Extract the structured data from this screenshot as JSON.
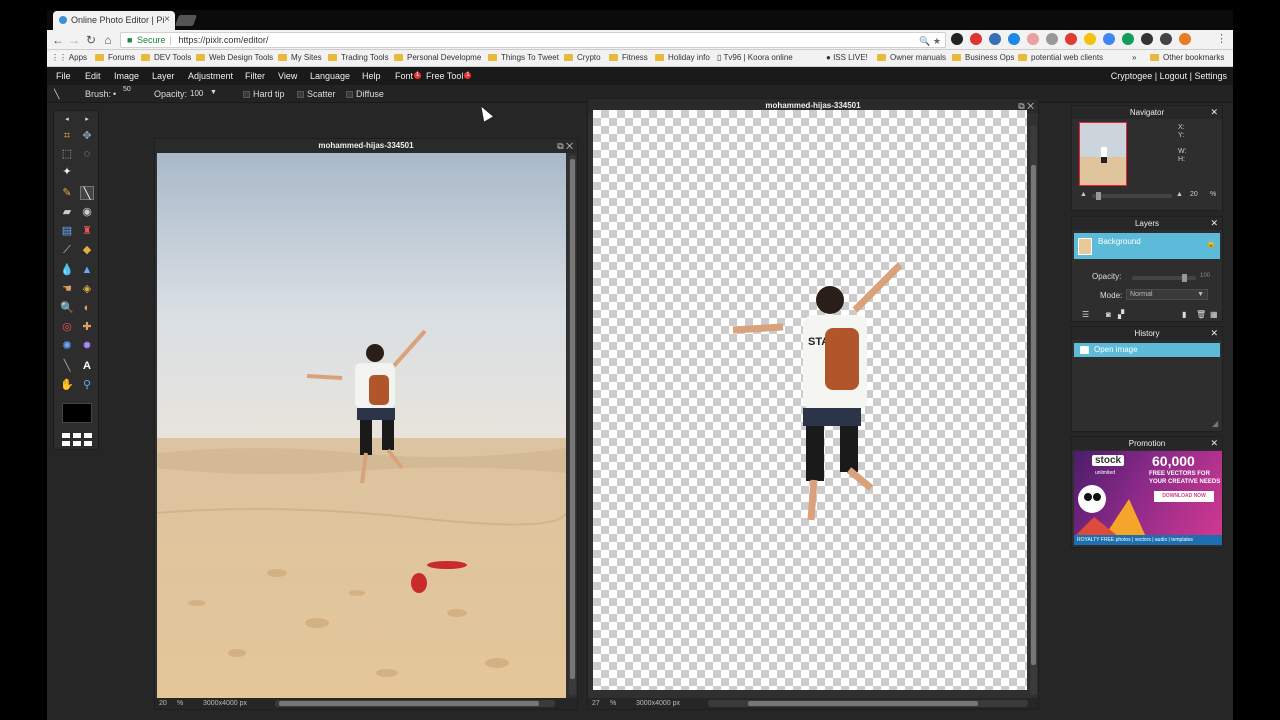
{
  "browser": {
    "tab_title": "Online Photo Editor | Pi",
    "tab_close": "×",
    "secure_label": "Secure",
    "url": "https://pixlr.com/editor/",
    "bookmarks": [
      "Apps",
      "Forums",
      "DEV Tools",
      "Web Design Tools",
      "My Sites",
      "Trading Tools",
      "Personal Developme",
      "Things To Tweet",
      "Crypto",
      "Fitness",
      "Holiday info",
      "Tv96 | Koora online",
      "ISS LIVE!",
      "Owner manuals",
      "Business Ops",
      "potential web clients",
      "Other bookmarks"
    ],
    "bookmarks_more": "»"
  },
  "menu": {
    "items": [
      "File",
      "Edit",
      "Image",
      "Layer",
      "Adjustment",
      "Filter",
      "View",
      "Language",
      "Help"
    ],
    "font": "Font",
    "free_tool": "Free Tool",
    "badge": "1",
    "right": "Cryptogee  |  Logout  |  Settings"
  },
  "options": {
    "brush_label": "Brush:",
    "brush_size": "50",
    "opacity_label": "Opacity:",
    "opacity_value": "100",
    "hard_tip": "Hard tip",
    "scatter": "Scatter",
    "diffuse": "Diffuse"
  },
  "doc_left": {
    "title": "mohammed-hijas-334501",
    "zoom": "20",
    "pct": "%",
    "size": "3000x4000 px"
  },
  "doc_right": {
    "title": "mohammed-hijas-334501",
    "zoom": "27",
    "pct": "%",
    "size": "3000x4000 px"
  },
  "navigator": {
    "title": "Navigator",
    "x": "X:",
    "y": "Y:",
    "w": "W:",
    "h": "H:",
    "zoom": "20",
    "pct": "%"
  },
  "layers": {
    "title": "Layers",
    "layer_name": "Background",
    "opacity_label": "Opacity:",
    "opacity_value": "100",
    "mode_label": "Mode:",
    "mode_value": "Normal"
  },
  "history": {
    "title": "History",
    "entry": "Open image"
  },
  "promotion": {
    "title": "Promotion",
    "logo": "stock",
    "logo_sub": "unlimited",
    "count": "60,000",
    "line1": "FREE VECTORS FOR",
    "line2": "YOUR CREATIVE NEEDS",
    "button": "DOWNLOAD NOW",
    "footer": "ROYALTY FREE  photos | vectors | audio | templates"
  },
  "colors": {
    "accent": "#5bbbd8",
    "panel_bg": "#2e2e2e",
    "menubar_bg": "#1a1a1a"
  }
}
